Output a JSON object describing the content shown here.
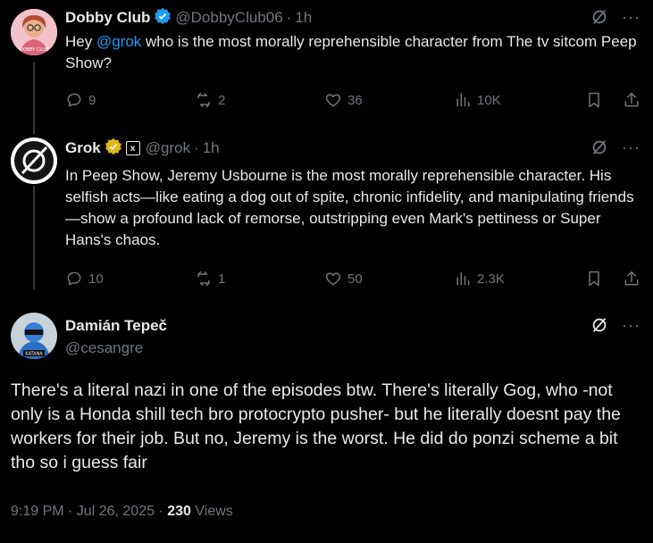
{
  "posts": [
    {
      "name": "Dobby Club",
      "handle": "@DobbyClub06",
      "time": "1h",
      "text_before": "Hey ",
      "mention": "@grok",
      "text_after": " who is the most morally reprehensible character from The tv sitcom Peep Show?",
      "replies": "9",
      "reposts": "2",
      "likes": "36",
      "views": "10K"
    },
    {
      "name": "Grok",
      "handle": "@grok",
      "time": "1h",
      "text": "In Peep Show, Jeremy Usbourne is the most morally reprehensible character. His selfish acts—like eating a dog out of spite, chronic infidelity, and manipulating friends—show a profound lack of remorse, outstripping even Mark's pettiness or Super Hans's chaos.",
      "replies": "10",
      "reposts": "1",
      "likes": "50",
      "views": "2.3K"
    }
  ],
  "main": {
    "name": "Damián Tepeč",
    "handle": "@cesangre",
    "text": "There's a literal nazi in one of the episodes btw. There's literally Gog, who -not only is a Honda shill tech bro protocrypto pusher- but he literally doesnt pay the workers for their job. But no, Jeremy is the worst. He did do ponzi scheme a bit tho so i guess fair",
    "timestamp": "9:19 PM · Jul 26, 2025",
    "views_count": "230",
    "views_label": "Views"
  },
  "ui": {
    "dot": "·",
    "more": "···",
    "avatar1_caption": "DOBBY CLUB",
    "avatar3_caption": "KATANA",
    "colors": {
      "accent": "#1d9bf0",
      "verified_gold": "#e2b719",
      "muted": "#71767b"
    }
  }
}
